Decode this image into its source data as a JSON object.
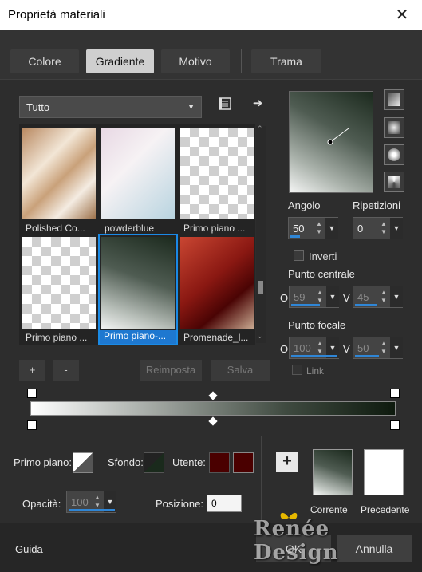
{
  "window": {
    "title": "Proprietà materiali",
    "close_icon": "close-icon"
  },
  "tabs": [
    {
      "label": "Colore"
    },
    {
      "label": "Gradiente"
    },
    {
      "label": "Motivo"
    },
    {
      "label": "Trama"
    }
  ],
  "library": {
    "filter": "Tutto",
    "items": [
      {
        "label": "Polished Co..."
      },
      {
        "label": "powderblue"
      },
      {
        "label": "Primo piano ..."
      },
      {
        "label": "Primo piano ..."
      },
      {
        "label": "Primo piano-..."
      },
      {
        "label": "Promenade_l..."
      }
    ],
    "buttons": {
      "add": "+",
      "remove": "-",
      "reset": "Reimposta",
      "save": "Salva"
    }
  },
  "gradient": {
    "angle_label": "Angolo",
    "angle": "50",
    "repeats_label": "Ripetizioni",
    "repeats": "0",
    "invert_label": "Inverti",
    "center_label": "Punto centrale",
    "center_h_prefix": "O",
    "center_h": "59",
    "center_v_prefix": "V",
    "center_v": "45",
    "focal_label": "Punto focale",
    "focal_h_prefix": "O",
    "focal_h": "100",
    "focal_v_prefix": "V",
    "focal_v": "50",
    "link_label": "Link"
  },
  "bottom": {
    "foreground_label": "Primo piano:",
    "background_label": "Sfondo:",
    "user_label": "Utente:",
    "opacity_label": "Opacità:",
    "opacity": "100",
    "position_label": "Posizione:",
    "position": "0",
    "add": "+",
    "current_label": "Corrente",
    "previous_label": "Precedente",
    "user_color": "#4a0000"
  },
  "footer": {
    "help": "Guida",
    "ok": "OK",
    "cancel": "Annulla",
    "watermark": "Renée Design"
  },
  "colors": {
    "accent": "#1e78d0",
    "dark_green": "#1a2a1c",
    "panel": "#2d2d2d"
  }
}
